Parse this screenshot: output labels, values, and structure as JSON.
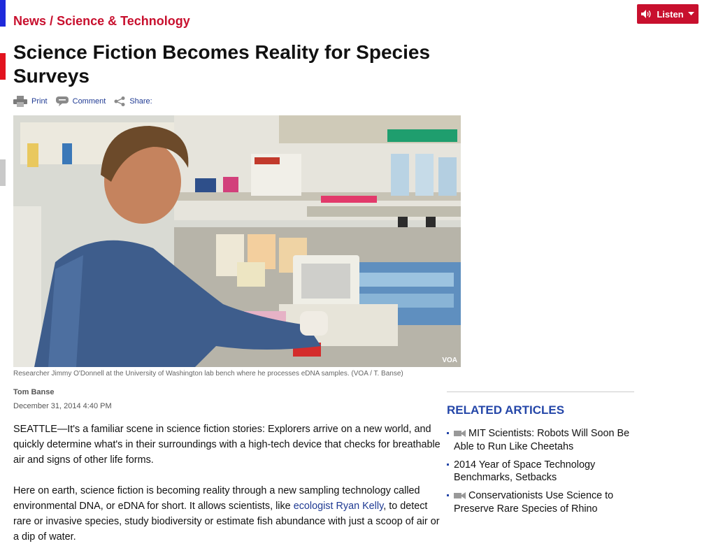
{
  "breadcrumb": {
    "section": "News",
    "separator": "/",
    "subsection": "Science & Technology"
  },
  "listen": {
    "label": "Listen"
  },
  "article": {
    "title": "Science Fiction Becomes Reality for Species Surveys",
    "tools": {
      "print": "Print",
      "comment": "Comment",
      "share": "Share:"
    },
    "image": {
      "watermark": "VOA",
      "caption": "Researcher Jimmy O'Donnell at the University of Washington lab bench where he processes eDNA samples. (VOA / T. Banse)"
    },
    "author": "Tom Banse",
    "date": "December 31, 2014 4:40 PM",
    "paragraphs": [
      "SEATTLE—It's a familiar scene in science fiction stories: Explorers arrive on a new world, and quickly determine what's in their surroundings with a high-tech device that checks for breathable air and signs of other life forms.",
      {
        "before": "Here on earth, science fiction is becoming reality through a new sampling technology called environmental DNA, or eDNA for short. It allows scientists, like ",
        "link": "ecologist Ryan Kelly",
        "after": ", to detect rare or invasive species, study biodiversity or estimate fish abundance with just a scoop of air or a dip of water."
      }
    ]
  },
  "related": {
    "heading": "RELATED ARTICLES",
    "items": [
      {
        "title": "MIT Scientists: Robots Will Soon Be Able to Run Like Cheetahs",
        "icon": "video-camera-icon"
      },
      {
        "title": "2014 Year of Space Technology Benchmarks, Setbacks",
        "icon": ""
      },
      {
        "title": "Conservationists Use Science to Preserve Rare Species of Rhino",
        "icon": "video-camera-icon"
      }
    ]
  },
  "colors": {
    "brand_red": "#c8102e",
    "link_blue": "#1f3a93",
    "related_blue": "#2446a8"
  }
}
